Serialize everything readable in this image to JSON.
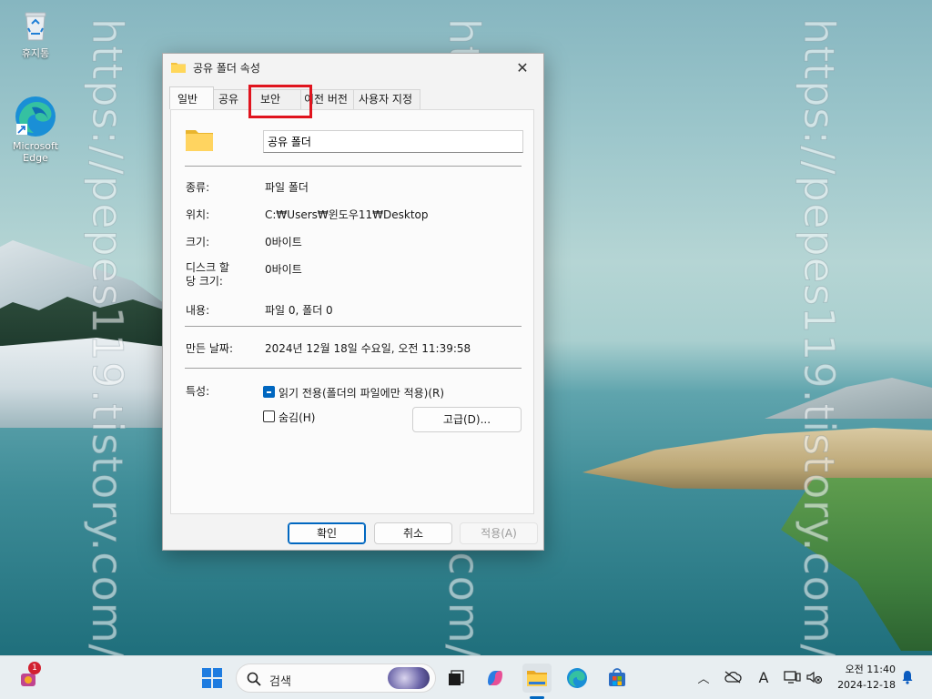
{
  "desktop": {
    "watermark": "https://pepes119.tistory.com/",
    "icons": [
      {
        "label": "휴지통"
      },
      {
        "label": "Microsoft Edge"
      }
    ]
  },
  "dialog": {
    "title": "공유 폴더 속성",
    "tabs": [
      {
        "label": "일반",
        "active": true
      },
      {
        "label": "공유"
      },
      {
        "label": "보안"
      },
      {
        "label": "이전 버전"
      },
      {
        "label": "사용자 지정"
      }
    ],
    "folder_name": "공유 폴더",
    "fields": {
      "type": {
        "label": "종류:",
        "value": "파일 폴더"
      },
      "location": {
        "label": "위치:",
        "value": "C:₩Users₩윈도우11₩Desktop"
      },
      "size": {
        "label": "크기:",
        "value": "0바이트"
      },
      "size_on_disk": {
        "label_line1": "디스크 할",
        "label_line2": "당 크기:",
        "value": "0바이트"
      },
      "contents": {
        "label": "내용:",
        "value": "파일 0, 폴더 0"
      },
      "created": {
        "label": "만든 날짜:",
        "value": "2024년 12월 18일 수요일, 오전 11:39:58"
      },
      "attributes": {
        "label": "특성:"
      }
    },
    "attributes": {
      "readonly": {
        "label": "읽기 전용(폴더의 파일에만 적용)(R)",
        "state": "indeterminate"
      },
      "hidden": {
        "label": "숨김(H)",
        "state": "unchecked"
      },
      "advanced_button": "고급(D)..."
    },
    "buttons": {
      "ok": "확인",
      "cancel": "취소",
      "apply": "적용(A)"
    }
  },
  "taskbar": {
    "notification_badge": "1",
    "search_placeholder": "검색",
    "clock": {
      "time": "오전 11:40",
      "date": "2024-12-18"
    },
    "accent": "#0067c0"
  }
}
